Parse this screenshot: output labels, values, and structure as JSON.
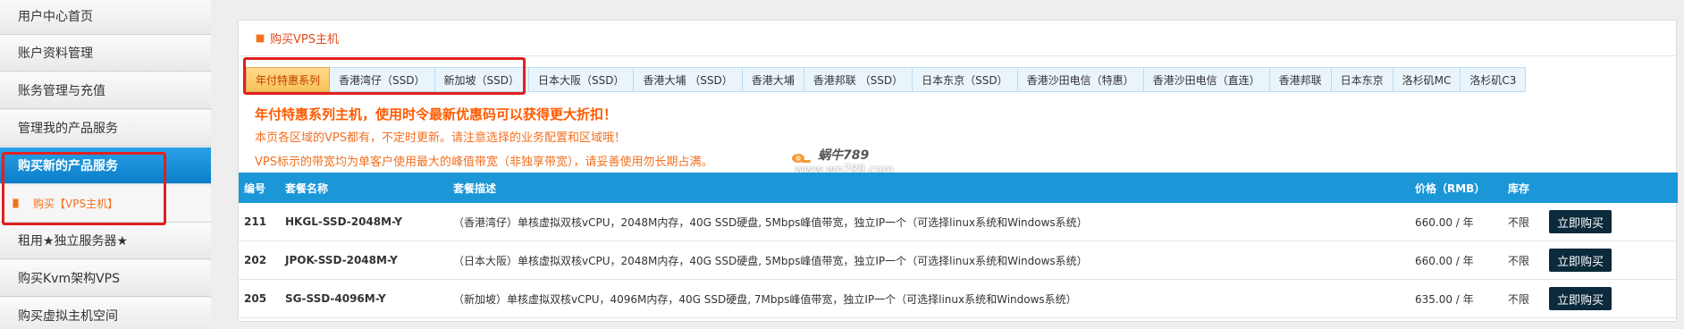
{
  "sidebar": {
    "items": [
      {
        "label": "用户中心首页"
      },
      {
        "label": "账户资料管理"
      },
      {
        "label": "账务管理与充值"
      },
      {
        "label": "管理我的产品服务"
      },
      {
        "label": "购买新的产品服务"
      },
      {
        "label": "购买【VPS主机】"
      },
      {
        "label": "租用★独立服务器★"
      },
      {
        "label": "购买Kvm架构VPS"
      },
      {
        "label": "购买虚拟主机空间"
      }
    ]
  },
  "panel": {
    "title": "购买VPS主机",
    "tabs": [
      {
        "label": "年付特惠系列"
      },
      {
        "label": "香港湾仔（SSD）"
      },
      {
        "label": "新加坡（SSD）"
      },
      {
        "label": "日本大阪（SSD）"
      },
      {
        "label": "香港大埔 （SSD）"
      },
      {
        "label": "香港大埔"
      },
      {
        "label": "香港邦联 （SSD）"
      },
      {
        "label": "日本东京（SSD）"
      },
      {
        "label": "香港沙田电信（特惠）"
      },
      {
        "label": "香港沙田电信（直连）"
      },
      {
        "label": "香港邦联"
      },
      {
        "label": "日本东京"
      },
      {
        "label": "洛杉矶MC"
      },
      {
        "label": "洛杉矶C3"
      }
    ],
    "notes": [
      "年付特惠系列主机，使用时令最新优惠码可以获得更大折扣！",
      "本页各区域的VPS都有，不定时更新。请注意选择的业务配置和区域哦！",
      "VPS标示的带宽均为单客户使用最大的峰值带宽（非独享带宽），请妥善使用勿长期占满。"
    ]
  },
  "watermark": {
    "name": "蜗牛789",
    "url": "www.wn789.com"
  },
  "table": {
    "headers": {
      "id": "编号",
      "name": "套餐名称",
      "desc": "套餐描述",
      "price": "价格（RMB）",
      "stock": "库存"
    },
    "rows": [
      {
        "id": "211",
        "name": "HKGL-SSD-2048M-Y",
        "desc": "（香港湾仔）单核虚拟双核vCPU，2048M内存，40G SSD硬盘, 5Mbps峰值带宽，独立IP一个（可选择linux系统和Windows系统）",
        "price": "660.00 / 年",
        "stock": "不限",
        "buy": "立即购买"
      },
      {
        "id": "202",
        "name": "JPOK-SSD-2048M-Y",
        "desc": "（日本大阪）单核虚拟双核vCPU，2048M内存，40G SSD硬盘, 5Mbps峰值带宽，独立IP一个（可选择linux系统和Windows系统）",
        "price": "660.00 / 年",
        "stock": "不限",
        "buy": "立即购买"
      },
      {
        "id": "205",
        "name": "SG-SSD-4096M-Y",
        "desc": "（新加坡）单核虚拟双核vCPU，4096M内存，40G SSD硬盘, 7Mbps峰值带宽，独立IP一个（可选择linux系统和Windows系统）",
        "price": "635.00 / 年",
        "stock": "不限",
        "buy": "立即购买"
      }
    ]
  },
  "colors": {
    "accent": "#1b97d7",
    "orange": "#f37021",
    "annotation_red": "#e02020",
    "button_dark": "#0b2a3b"
  }
}
